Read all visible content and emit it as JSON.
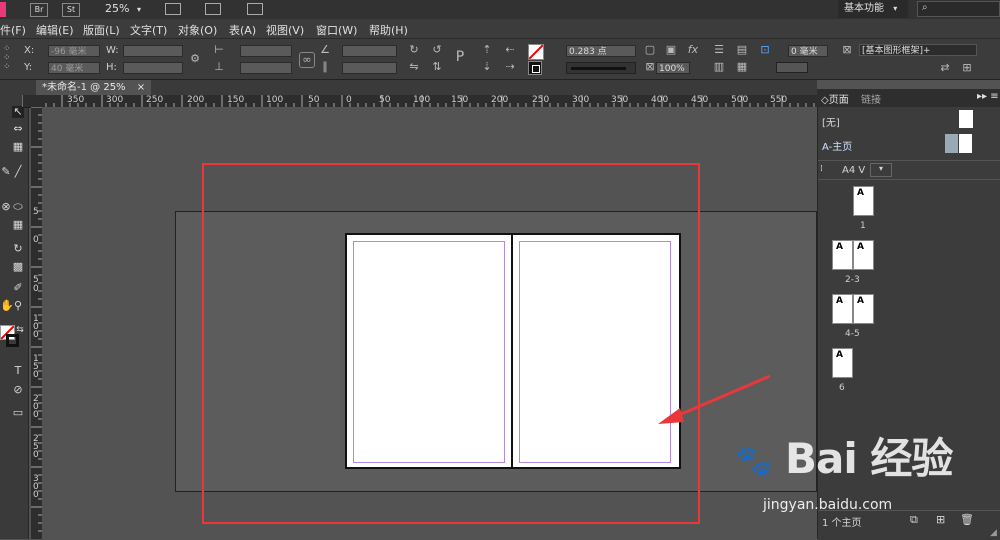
{
  "app_bar": {
    "br_label": "Br",
    "st_label": "St",
    "zoom": "25%",
    "workspace": "基本功能",
    "search_placeholder": ""
  },
  "menu": [
    {
      "label": "件(F)"
    },
    {
      "label": "编辑(E)"
    },
    {
      "label": "版面(L)"
    },
    {
      "label": "文字(T)"
    },
    {
      "label": "对象(O)"
    },
    {
      "label": "表(A)"
    },
    {
      "label": "视图(V)"
    },
    {
      "label": "窗口(W)"
    },
    {
      "label": "帮助(H)"
    }
  ],
  "control": {
    "x_label": "X:",
    "x_value": "-96 毫米",
    "y_label": "Y:",
    "y_value": "40 毫米",
    "w_label": "W:",
    "h_label": "H:",
    "stroke_weight": "0.283 点",
    "opacity": "100%",
    "offset": "0 毫米",
    "style": "[基本图形框架]+"
  },
  "tab": {
    "title": "*未命名-1 @ 25%",
    "close": "×"
  },
  "ruler": {
    "ticks": [
      "350",
      "300",
      "250",
      "200",
      "150",
      "100",
      "50",
      "0",
      "50",
      "100",
      "150",
      "200",
      "250",
      "300",
      "350",
      "400",
      "450",
      "500",
      "550"
    ],
    "vticks": [
      "5",
      "0",
      "5",
      "0",
      "1 0 0",
      "1 5 0",
      "2 0 0",
      "2 5 0",
      "3 0 0"
    ]
  },
  "pages_panel": {
    "tab_pages": "页面",
    "tab_links": "链接",
    "none_label": "[无]",
    "master_label": "A-主页",
    "page_size": "A4 V",
    "pages": [
      {
        "label": "1",
        "marks": [
          "A"
        ]
      },
      {
        "label": "2-3",
        "marks": [
          "A",
          "A"
        ]
      },
      {
        "label": "4-5",
        "marks": [
          "A",
          "A"
        ]
      },
      {
        "label": "6",
        "marks": [
          "A"
        ]
      }
    ],
    "footer": "1 个主页"
  },
  "watermark": {
    "brand": "Bai 经验",
    "url": "jingyan.baidu.com"
  },
  "colors": {
    "highlight": "#e8383a",
    "arrow": "#e8383a",
    "margin_guide": "#b48ae0"
  }
}
